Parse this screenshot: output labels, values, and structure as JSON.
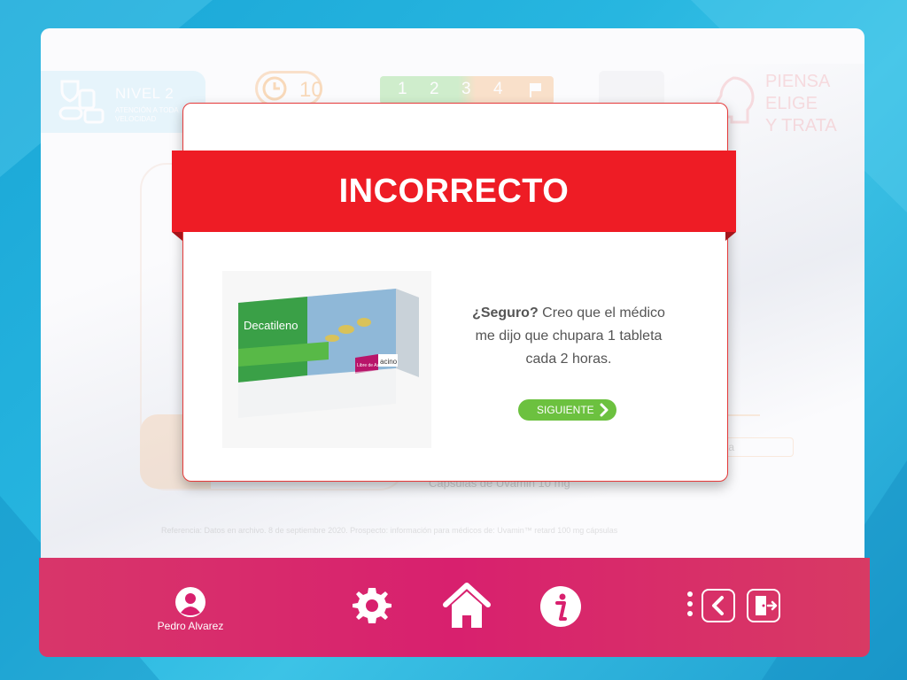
{
  "level": {
    "title": "NIVEL 2",
    "subtitle": "ATENCIÓN A TODA VELOCIDAD"
  },
  "timer": {
    "value": "10"
  },
  "steps": {
    "items": [
      "1",
      "2",
      "3",
      "4"
    ]
  },
  "slogan": {
    "lines": [
      "PIENSA",
      "ELIGE",
      "Y TRATA"
    ]
  },
  "background": {
    "option_label": "ácia",
    "capsulas_label": "Cápsulas de Uvamin   10 mg",
    "reference": "Referencia: Datos en archivo. 8 de septiembre 2020. Prospecto: información para médicos de: Uvamin™ retard 100 mg cápsulas"
  },
  "modal": {
    "banner": "INCORRECTO",
    "message_bold": "¿Seguro?",
    "message_rest": " Creo que el médico me dijo que chupara 1 tableta cada 2 horas.",
    "next_button": "SIGUIENTE",
    "product": {
      "brand": "Decatileno",
      "maker": "acino",
      "badge": "Libre de Azúcar"
    }
  },
  "footer": {
    "user_name": "Pedro Alvarez"
  },
  "colors": {
    "banner": "#ee1c25",
    "next_button": "#6cc13f",
    "footer": "#d8206e"
  },
  "icons": [
    "user-avatar-icon",
    "gear-icon",
    "home-icon",
    "info-icon",
    "more-dots-icon",
    "back-chevron-icon",
    "exit-door-icon"
  ]
}
